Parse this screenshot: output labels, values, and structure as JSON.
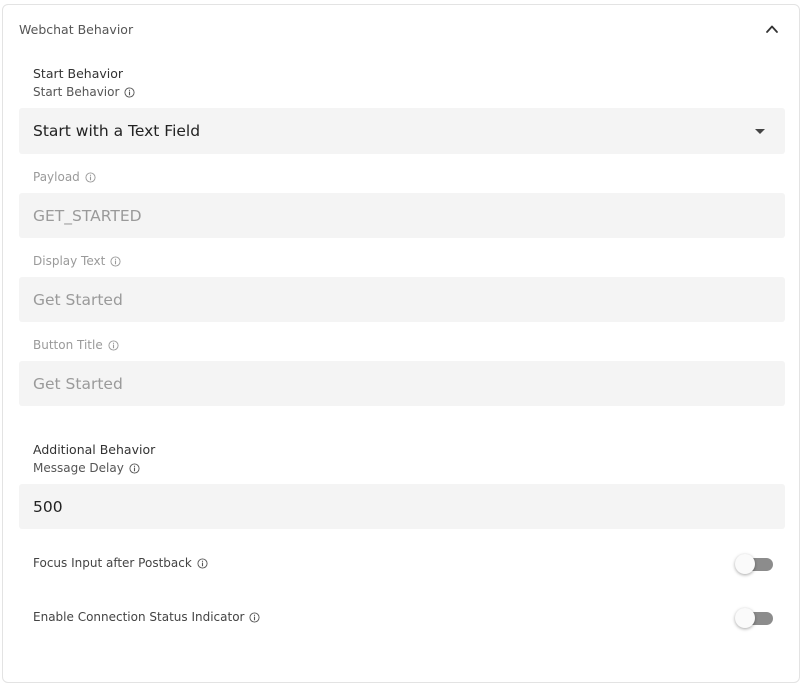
{
  "panel": {
    "title": "Webchat Behavior",
    "expanded": true
  },
  "start_behavior": {
    "section_title": "Start Behavior",
    "label": "Start Behavior",
    "selected": "Start with a Text Field",
    "payload": {
      "label": "Payload",
      "value": "GET_STARTED",
      "disabled": true
    },
    "display_text": {
      "label": "Display Text",
      "value": "Get Started",
      "disabled": true
    },
    "button_title": {
      "label": "Button Title",
      "value": "Get Started",
      "disabled": true
    }
  },
  "additional_behavior": {
    "section_title": "Additional Behavior",
    "message_delay": {
      "label": "Message Delay",
      "value": "500"
    },
    "focus_input": {
      "label": "Focus Input after Postback",
      "enabled": false
    },
    "connection_status": {
      "label": "Enable Connection Status Indicator",
      "enabled": false
    }
  },
  "colors": {
    "field_background": "#f4f4f4",
    "toggle_track_off": "#8c8c8c",
    "disabled_text": "#9a9a9a"
  },
  "icons": {
    "collapse": "chevron-up-icon",
    "dropdown": "caret-down-icon",
    "info": "info-icon"
  }
}
